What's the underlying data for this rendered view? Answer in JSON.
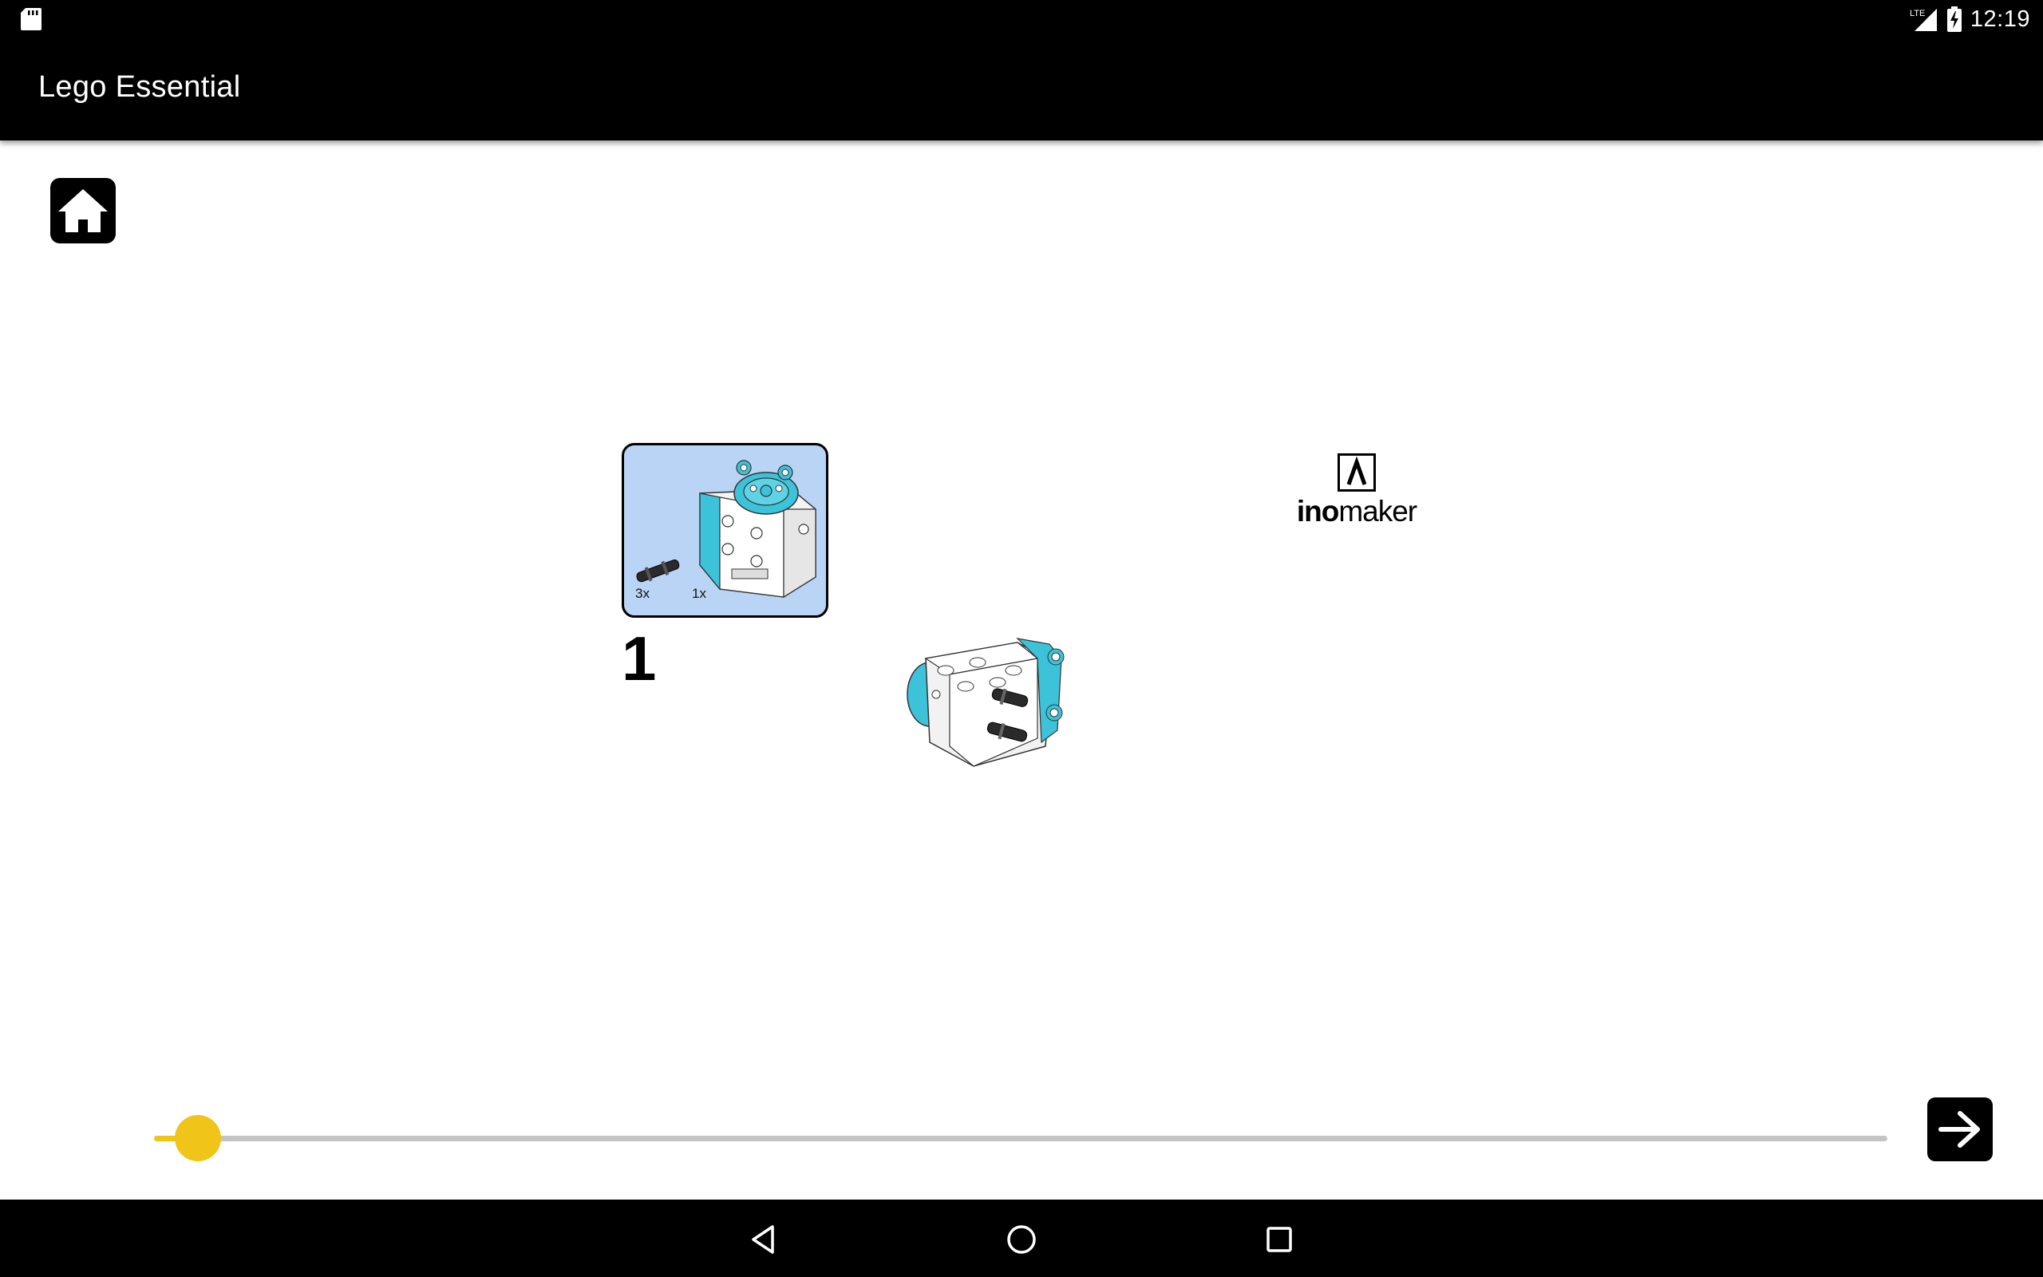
{
  "status_bar": {
    "network": "LTE",
    "time": "12:19",
    "icons": [
      "sd-card-icon",
      "signal-icon",
      "battery-charging-icon"
    ]
  },
  "app_bar": {
    "title": "Lego Essential"
  },
  "home_button": {
    "icon": "home-icon"
  },
  "instruction": {
    "step_number": "1",
    "parts": [
      {
        "name": "connector-peg",
        "quantity": "3x"
      },
      {
        "name": "motor",
        "quantity": "1x"
      }
    ]
  },
  "logo": {
    "brand_bold": "ino",
    "brand_regular": "maker",
    "mark": "Λ"
  },
  "progress": {
    "value": 0.012
  },
  "next_button": {
    "icon": "arrow-right-icon"
  },
  "nav_bar": {
    "items": [
      "back-icon",
      "home-circle-icon",
      "recents-icon"
    ]
  },
  "colors": {
    "accent": "#f0c419",
    "parts_bg": "#b9d4f4",
    "brick_teal": "#3cc2d9"
  }
}
